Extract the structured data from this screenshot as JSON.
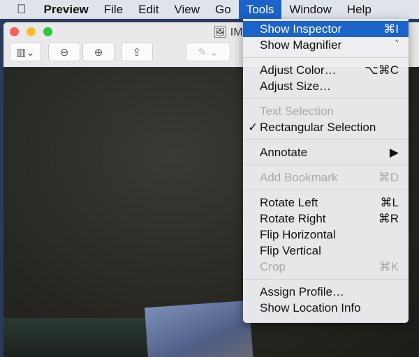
{
  "menubar": {
    "apple": "",
    "app": "Preview",
    "items": [
      "File",
      "Edit",
      "View",
      "Go",
      "Tools",
      "Window",
      "Help"
    ]
  },
  "window": {
    "title": "IMG"
  },
  "tools_menu": {
    "groups": [
      [
        {
          "label": "Show Inspector",
          "shortcut": "⌘I",
          "highlighted": true
        },
        {
          "label": "Show Magnifier",
          "shortcut": "`"
        }
      ],
      [
        {
          "label": "Adjust Color…",
          "shortcut": "⌥⌘C"
        },
        {
          "label": "Adjust Size…",
          "shortcut": ""
        }
      ],
      [
        {
          "label": "Text Selection",
          "shortcut": "",
          "disabled": true
        },
        {
          "label": "Rectangular Selection",
          "shortcut": "",
          "checked": true,
          "check": "✓"
        }
      ],
      [
        {
          "label": "Annotate",
          "shortcut": "▶"
        }
      ],
      [
        {
          "label": "Add Bookmark",
          "shortcut": "⌘D",
          "disabled": true
        }
      ],
      [
        {
          "label": "Rotate Left",
          "shortcut": "⌘L"
        },
        {
          "label": "Rotate Right",
          "shortcut": "⌘R"
        },
        {
          "label": "Flip Horizontal",
          "shortcut": ""
        },
        {
          "label": "Flip Vertical",
          "shortcut": ""
        },
        {
          "label": "Crop",
          "shortcut": "⌘K",
          "disabled": true
        }
      ],
      [
        {
          "label": "Assign Profile…",
          "shortcut": ""
        },
        {
          "label": "Show Location Info",
          "shortcut": ""
        }
      ]
    ]
  }
}
